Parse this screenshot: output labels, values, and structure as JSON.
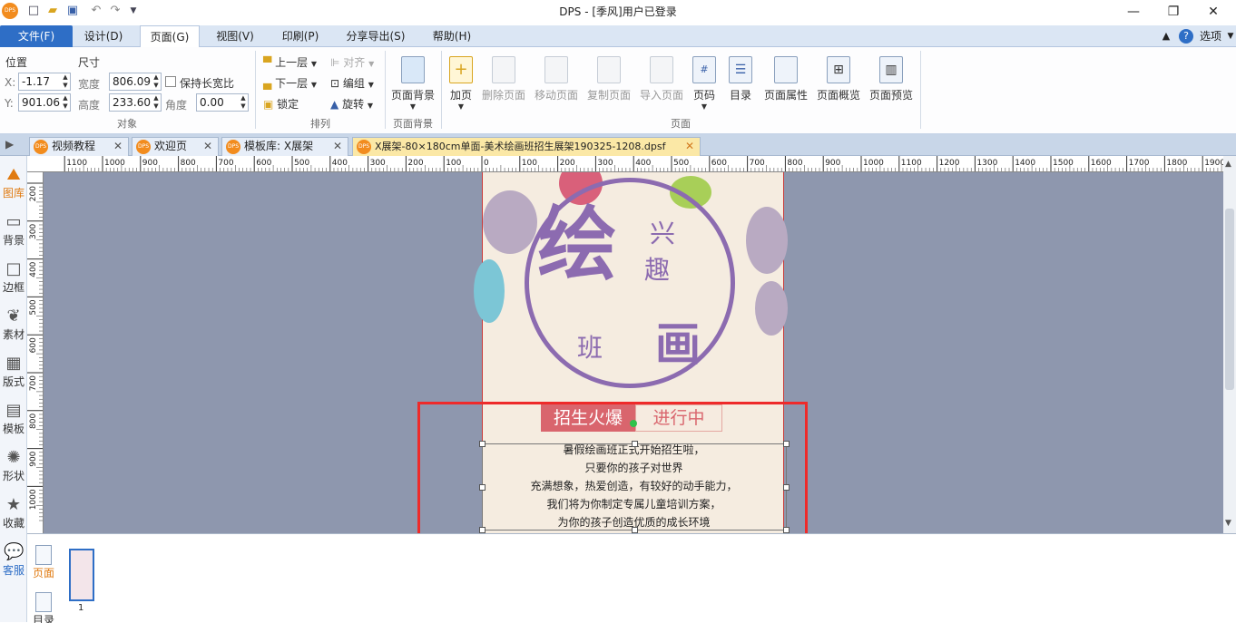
{
  "window": {
    "title": "DPS - [季风]用户已登录"
  },
  "menu": {
    "file": "文件(F)",
    "design": "设计(D)",
    "page": "页面(G)",
    "view": "视图(V)",
    "print": "印刷(P)",
    "share": "分享导出(S)",
    "help": "帮助(H)",
    "options": "选项"
  },
  "ribbon": {
    "position_label": "位置",
    "size_label": "尺寸",
    "x_label": "X:",
    "x_value": "-1.17",
    "y_label": "Y:",
    "y_value": "901.06",
    "width_label": "宽度",
    "width_value": "806.09",
    "height_label": "高度",
    "height_value": "233.60",
    "keep_ratio": "保持长宽比",
    "angle_label": "角度",
    "angle_value": "0.00",
    "group_object": "对象",
    "move_up": "上一层",
    "move_down": "下一层",
    "align": "对齐",
    "group": "编组",
    "lock": "锁定",
    "rotate": "旋转",
    "group_arrange": "排列",
    "page_bg": "页面背景",
    "group_pagebg": "页面背景",
    "add_page": "加页",
    "delete_page": "删除页面",
    "move_page": "移动页面",
    "copy_page": "复制页面",
    "import_page": "导入页面",
    "page_number": "页码",
    "toc": "目录",
    "page_props": "页面属性",
    "page_overview": "页面概览",
    "page_preview": "页面预览",
    "group_page": "页面"
  },
  "tabs": [
    {
      "label": "视频教程"
    },
    {
      "label": "欢迎页"
    },
    {
      "label": "模板库: X展架"
    },
    {
      "label": "X展架-80×180cm单面-美术绘画班招生展架190325-1208.dpsf"
    }
  ],
  "left_tools": [
    "图库",
    "背景",
    "边框",
    "素材",
    "版式",
    "模板",
    "形状",
    "收藏",
    "客服"
  ],
  "hruler_labels": [
    "1100",
    "1000",
    "900",
    "800",
    "700",
    "600",
    "500",
    "400",
    "300",
    "200",
    "100",
    "0",
    "100",
    "200",
    "300",
    "400",
    "500",
    "600",
    "700",
    "800",
    "900",
    "1000",
    "1100",
    "1200",
    "1300",
    "1400",
    "1500",
    "1600",
    "1700",
    "1800",
    "1900"
  ],
  "vruler_labels": [
    "200",
    "300",
    "400",
    "500",
    "600",
    "700",
    "800",
    "900",
    "1000"
  ],
  "poster": {
    "big_char": "绘",
    "char_xing": "兴",
    "char_qu": "趣",
    "char_ban": "班",
    "char_hua": "画",
    "banner_left": "招生火爆",
    "banner_right": "进行中",
    "body_lines": [
      "暑假绘画班正式开始招生啦，",
      "只要你的孩子对世界",
      "充满想象，热爱创造，有较好的动手能力，",
      "我们将为你制定专属儿童培训方案，",
      "为你的孩子创造优质的成长环境"
    ]
  },
  "bottom": {
    "tab_page": "页面",
    "tab_second": "目录",
    "thumb_number": "1"
  }
}
